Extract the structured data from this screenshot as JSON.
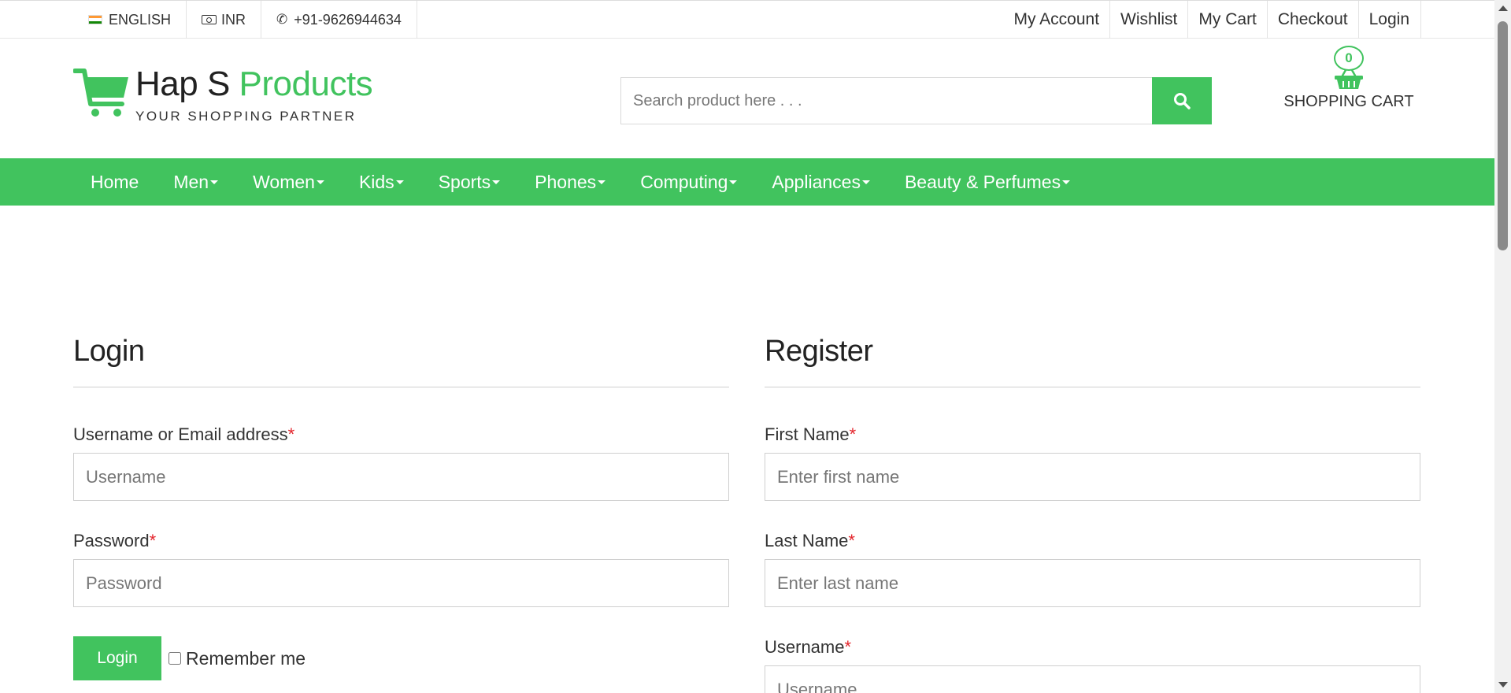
{
  "topbar": {
    "language": "ENGLISH",
    "currency": "INR",
    "phone": "+91-9626944634",
    "links": [
      "My Account",
      "Wishlist",
      "My Cart",
      "Checkout",
      "Login"
    ]
  },
  "header": {
    "brand_prefix": "Hap S",
    "brand_suffix": "Products",
    "tagline": "YOUR SHOPPING PARTNER",
    "search_placeholder": "Search product here . . .",
    "cart_count": "0",
    "cart_label": "SHOPPING CART"
  },
  "nav": {
    "items": [
      "Home",
      "Men",
      "Women",
      "Kids",
      "Sports",
      "Phones",
      "Computing",
      "Appliances",
      "Beauty & Perfumes"
    ]
  },
  "login": {
    "title": "Login",
    "username_label": "Username or Email address",
    "username_placeholder": "Username",
    "password_label": "Password",
    "password_placeholder": "Password",
    "button_label": "Login",
    "remember_label": "Remember me",
    "required_mark": "*"
  },
  "register": {
    "title": "Register",
    "first_name_label": "First Name",
    "first_name_placeholder": "Enter first name",
    "last_name_label": "Last Name",
    "last_name_placeholder": "Enter last name",
    "username_label": "Username",
    "username_placeholder": "Username",
    "required_mark": "*"
  },
  "colors": {
    "accent": "#41c35e",
    "required": "#e3242b"
  }
}
